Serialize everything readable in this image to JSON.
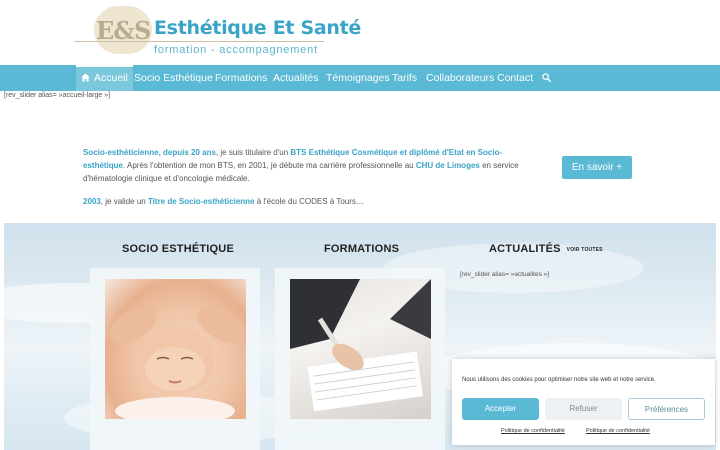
{
  "logo": {
    "initials": "E&S",
    "name": "Esthétique Et Santé",
    "tagline": "formation - accompagnement"
  },
  "nav": {
    "items": [
      {
        "label": "Accueil",
        "icon": "home-icon",
        "active": true
      },
      {
        "label": "Socio Esthétique"
      },
      {
        "label": "Formations"
      },
      {
        "label": "Actualités"
      },
      {
        "label": "Témoignages"
      },
      {
        "label": "Tarifs"
      },
      {
        "label": "Collaborateurs"
      },
      {
        "label": "Contact"
      }
    ],
    "search_icon": "search-icon"
  },
  "shortcode_top": "[rev_slider alias= »accueil-large »]",
  "intro": {
    "p1": {
      "hl1": "Socio-esthéticienne, depuis 20 ans",
      "t1": ", je suis titulaire d'un ",
      "hl2": "BTS Esthétique Cosmétique et diplômé d'Etat en Socio-esthétique",
      "t2": ". Après l'obtention de mon BTS, en 2001, je débute ma carrière professionnelle au ",
      "hl3": "CHU de Limoges",
      "t3": " en service d'hématologie clinique et d'oncologie médicale."
    },
    "p2": {
      "hl1": "2003",
      "t1": ", je valide un ",
      "hl2": "Titre de Socio-esthéticienne",
      "t2": " à l'école du CODES à Tours…"
    }
  },
  "cta": {
    "label": "En savoir +"
  },
  "sections": {
    "socio": {
      "title": "SOCIO ESTHÉTIQUE"
    },
    "formations": {
      "title": "FORMATIONS"
    },
    "actualites": {
      "title": "ACTUALITÉS",
      "see_all": "VOIR TOUTES",
      "shortcode": "[rev_slider alias= »actualites »]"
    }
  },
  "cookie": {
    "text": "Nous utilisons des cookies pour optimiser notre site web et notre service.",
    "accept": "Accepter",
    "refuse": "Refuser",
    "preferences": "Préférences",
    "link1": "Politique de confidentialité",
    "link2": "Politique de confidentialité"
  },
  "colors": {
    "brand": "#5ab9d4",
    "accent_text": "#3aa4c6"
  }
}
